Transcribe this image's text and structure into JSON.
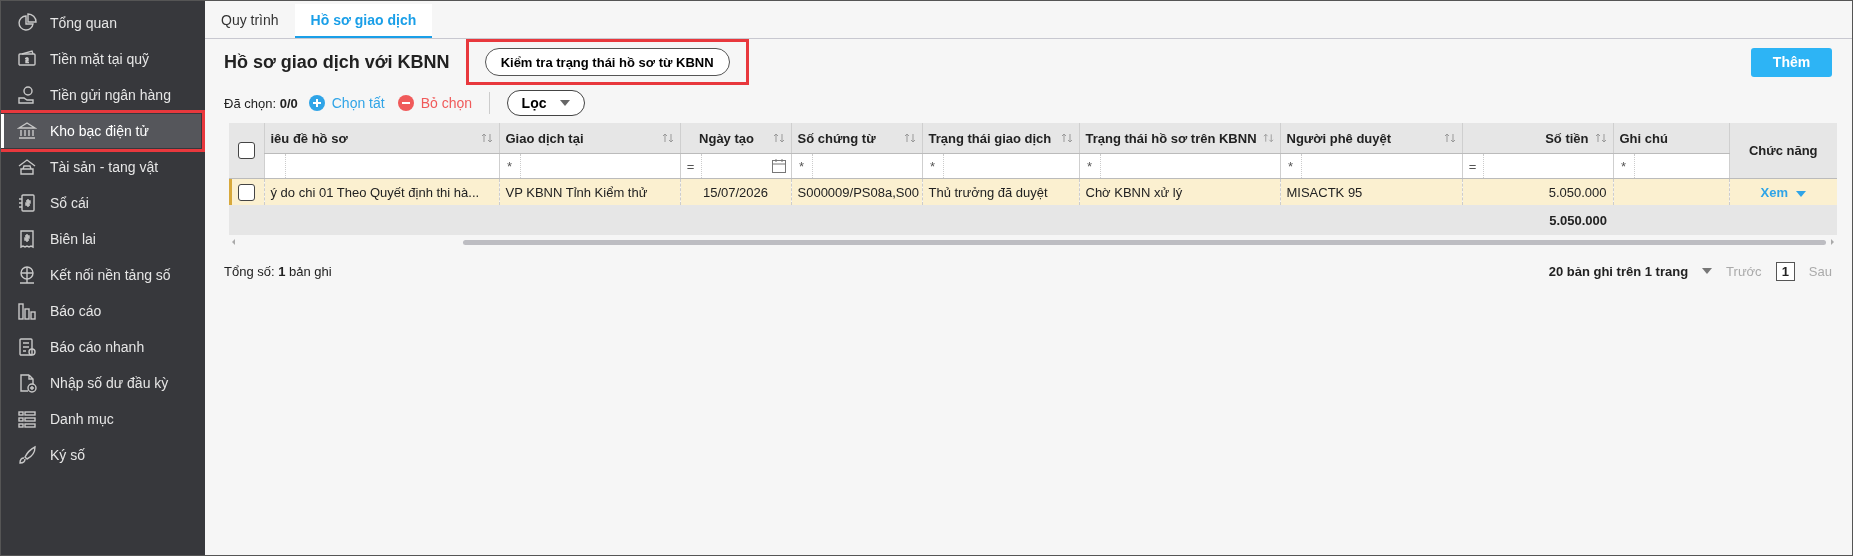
{
  "sidebar": {
    "items": [
      {
        "label": "Tổng quan",
        "selected": false,
        "highlighted": false
      },
      {
        "label": "Tiền mặt tại quỹ",
        "selected": false,
        "highlighted": false
      },
      {
        "label": "Tiền gửi ngân hàng",
        "selected": false,
        "highlighted": false
      },
      {
        "label": "Kho bạc điện tử",
        "selected": true,
        "highlighted": true
      },
      {
        "label": "Tài sản - tang vật",
        "selected": false,
        "highlighted": false
      },
      {
        "label": "Sổ cái",
        "selected": false,
        "highlighted": false
      },
      {
        "label": "Biên lai",
        "selected": false,
        "highlighted": false
      },
      {
        "label": "Kết nối nền tảng số",
        "selected": false,
        "highlighted": false
      },
      {
        "label": "Báo cáo",
        "selected": false,
        "highlighted": false
      },
      {
        "label": "Báo cáo nhanh",
        "selected": false,
        "highlighted": false
      },
      {
        "label": "Nhập số dư đầu kỳ",
        "selected": false,
        "highlighted": false
      },
      {
        "label": "Danh mục",
        "selected": false,
        "highlighted": false
      },
      {
        "label": "Ký số",
        "selected": false,
        "highlighted": false
      }
    ]
  },
  "tabs": [
    {
      "label": "Quy trình",
      "selected": false
    },
    {
      "label": "Hồ sơ giao dịch",
      "selected": true
    }
  ],
  "page_title": "Hồ sơ giao dịch với KBNN",
  "check_status_button": {
    "label": "Kiểm tra trạng thái hồ sơ từ KBNN",
    "highlighted": true
  },
  "add_button": "Thêm",
  "toolbar": {
    "selected_label": "Đã chọn: **0/0**",
    "select_all": "Chọn tất",
    "deselect": "Bỏ chọn",
    "filter": "Lọc"
  },
  "table": {
    "header_checked": false,
    "columns": [
      {
        "label": "iêu đề hồ sơ",
        "sortable": true,
        "kind": "text"
      },
      {
        "label": "Giao dịch tại",
        "sortable": true,
        "kind": "text",
        "filter_op": "*"
      },
      {
        "label": "Ngày tạo",
        "sortable": true,
        "kind": "date",
        "filter_op": "=",
        "date_picker": true
      },
      {
        "label": "Số chứng từ",
        "sortable": true,
        "kind": "text",
        "filter_op": "*"
      },
      {
        "label": "Trạng thái giao dịch",
        "sortable": true,
        "kind": "text",
        "filter_op": "*"
      },
      {
        "label": "Trạng thái hồ sơ trên KBNN",
        "sortable": true,
        "kind": "text",
        "filter_op": "*"
      },
      {
        "label": "Người phê duyệt",
        "sortable": true,
        "kind": "text",
        "filter_op": "*"
      },
      {
        "label": "Số tiền",
        "sortable": true,
        "kind": "amount",
        "filter_op": "=",
        "total": "5.050.000"
      },
      {
        "label": "Ghi chú",
        "sortable": false,
        "kind": "text",
        "filter_op": "*"
      }
    ],
    "action_column": "Chức năng",
    "rows": [
      {
        "checked": false,
        "focused": true,
        "cells": [
          "ý do chi 01 Theo Quyết định thi hà...",
          "VP KBNN Tỉnh Kiểm thử",
          "15/07/2026",
          "S000009/PS08a,S00",
          "Thủ trưởng đã duyệt",
          "Chờ KBNN xử lý",
          "MISACTK 95",
          "5.050.000",
          null
        ],
        "action": "Xem"
      }
    ]
  },
  "footer": {
    "total": "Tổng số: **1** bản ghi",
    "page_size": "20 bản ghi trên 1 trang",
    "prev": {
      "label": "Trước",
      "disabled": true
    },
    "page": "1",
    "next": {
      "label": "Sau",
      "disabled": true
    }
  }
}
